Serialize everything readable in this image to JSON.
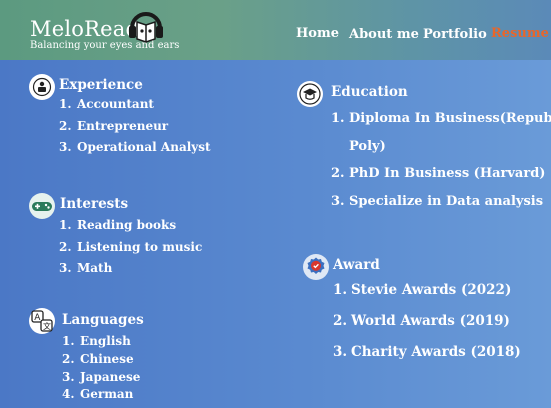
{
  "brand": {
    "title": "MeloReads",
    "tagline": "Balancing your eyes and ears"
  },
  "nav": {
    "items": [
      "Home",
      "About me",
      "Portfolio",
      "Resume"
    ],
    "active": "Resume"
  },
  "experience": {
    "title": "Experience",
    "items": [
      "Accountant",
      "Entrepreneur",
      "Operational Analyst"
    ]
  },
  "interests": {
    "title": "Interests",
    "items": [
      "Reading books",
      "Listening to music",
      "Math"
    ]
  },
  "languages": {
    "title": "Languages",
    "items": [
      "English",
      "Chinese",
      "Japanese",
      "German"
    ]
  },
  "education": {
    "title": "Education",
    "items": [
      "Diploma In Business(Republic",
      "Poly)",
      "PhD In Business (Harvard)",
      "Specialize in Data analysis"
    ]
  },
  "award": {
    "title": "Award",
    "items": [
      "Stevie Awards (2022)",
      "World Awards (2019)",
      "Charity Awards (2018)"
    ]
  },
  "numbers": [
    "1.",
    "2.",
    "3.",
    "4."
  ],
  "colors": {
    "active_nav": "#e8662a",
    "header": "#62a08a",
    "background": "#5a8ad0"
  }
}
